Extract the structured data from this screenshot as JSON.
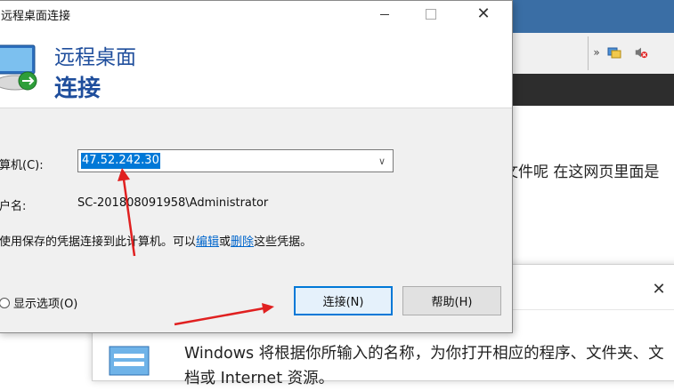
{
  "background": {
    "page_text": "文件呢 在这网页里面是"
  },
  "run_dialog": {
    "close_glyph": "✕",
    "text": "Windows 将根据你所输入的名称，为你打开相应的程序、文件夹、文档或 Internet 资源。"
  },
  "rdp": {
    "title": "远程桌面连接",
    "header_line1": "远程桌面",
    "header_line2": "连接",
    "computer_label": "算机(C):",
    "computer_value": "47.52.242.30",
    "user_label": "户名:",
    "user_value": "SC-201808091958\\Administrator",
    "note_before": "使用保存的凭据连接到此计算机。可以",
    "note_edit": "编辑",
    "note_or": "或",
    "note_delete": "删除",
    "note_after": "这些凭据。",
    "options_label": "显示选项(O)",
    "connect_button": "连接(N)",
    "help_button": "帮助(H)"
  },
  "colors": {
    "accent": "#0078d7",
    "header_text": "#1f4e9c",
    "annotation_arrow": "#e02020"
  }
}
